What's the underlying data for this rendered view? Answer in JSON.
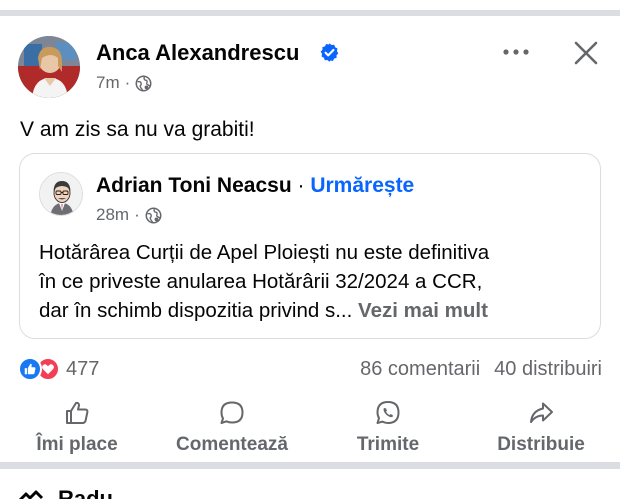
{
  "post": {
    "author": "Anca Alexandrescu",
    "time": "7m",
    "separator": "·",
    "text": "V am zis sa nu va grabiti!"
  },
  "shared": {
    "author": "Adrian Toni Neacsu",
    "separator": "·",
    "follow_label": "Urmărește",
    "time": "28m",
    "body_line1": "Hotărârea Curții de Apel Ploiești nu este definitiva",
    "body_line2": "în ce priveste anularea Hotărârii 32/2024 a CCR,",
    "body_line3": "dar în schimb dispozitia privind s...",
    "see_more": "Vezi mai mult"
  },
  "stats": {
    "reaction_count": "477",
    "comments": "86 comentarii",
    "shares": "40 distribuiri"
  },
  "actions": {
    "like": "Îmi place",
    "comment": "Comentează",
    "send": "Trimite",
    "share": "Distribuie"
  },
  "next_post": {
    "title": "Radu"
  },
  "colors": {
    "accent": "#0866ff",
    "secondary_text": "#65676b",
    "divider": "#dadde1",
    "like": "#1877f2",
    "love": "#f33e58"
  },
  "icons": {
    "verified": "verified-badge-icon",
    "privacy": "globe-icon",
    "more": "more-horizontal-icon",
    "close": "close-icon",
    "like": "thumbs-up-icon",
    "comment": "comment-bubble-icon",
    "send": "whatsapp-icon",
    "share": "share-arrow-icon"
  }
}
